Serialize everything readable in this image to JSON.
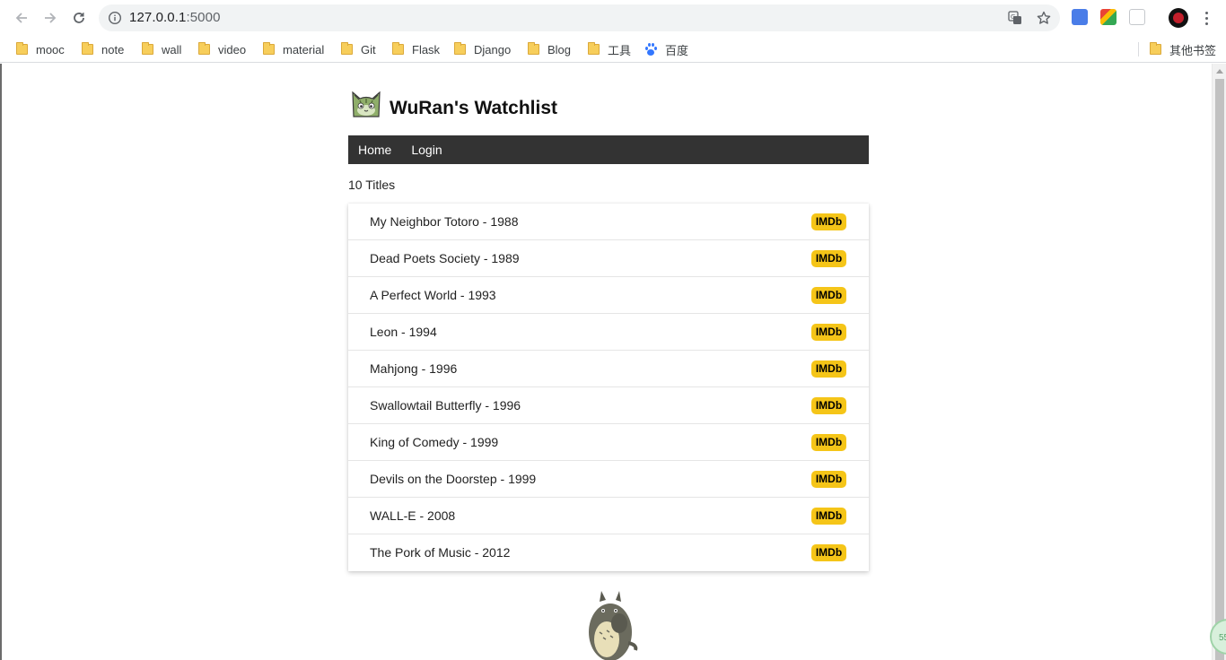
{
  "browser": {
    "url_host": "127.0.0.1",
    "url_port": ":5000",
    "bookmarks": [
      {
        "label": "mooc",
        "icon": "folder-icon"
      },
      {
        "label": "note",
        "icon": "folder-icon"
      },
      {
        "label": "wall",
        "icon": "folder-icon"
      },
      {
        "label": "video",
        "icon": "folder-icon"
      },
      {
        "label": "material",
        "icon": "folder-icon"
      },
      {
        "label": "Git",
        "icon": "folder-icon"
      },
      {
        "label": "Flask",
        "icon": "folder-icon"
      },
      {
        "label": "Django",
        "icon": "folder-icon"
      },
      {
        "label": "Blog",
        "icon": "folder-icon"
      },
      {
        "label": "工具",
        "icon": "folder-icon"
      },
      {
        "label": "百度",
        "icon": "baidu-paw-icon"
      }
    ],
    "other_bookmarks": "其他书签",
    "fab_text": "55"
  },
  "site": {
    "title": "WuRan's Watchlist",
    "nav": [
      {
        "label": "Home"
      },
      {
        "label": "Login"
      }
    ],
    "count_text": "10 Titles",
    "imdb_label": "IMDb",
    "movies": [
      {
        "title": "My Neighbor Totoro - 1988"
      },
      {
        "title": "Dead Poets Society - 1989"
      },
      {
        "title": "A Perfect World - 1993"
      },
      {
        "title": "Leon - 1994"
      },
      {
        "title": "Mahjong - 1996"
      },
      {
        "title": "Swallowtail Butterfly - 1996"
      },
      {
        "title": "King of Comedy - 1999"
      },
      {
        "title": "Devils on the Doorstep - 1999"
      },
      {
        "title": "WALL-E - 2008"
      },
      {
        "title": "The Pork of Music - 2012"
      }
    ]
  },
  "colors": {
    "navbar": "#333333",
    "imdb_badge": "#f5c518",
    "folder": "#f7ce5b"
  }
}
